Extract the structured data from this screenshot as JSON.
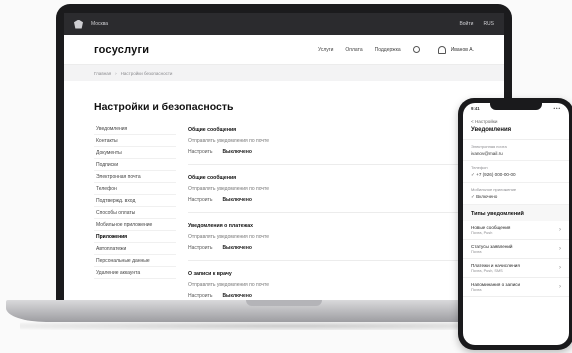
{
  "laptop": {
    "topbar": {
      "region": "Москва",
      "right_a": "Войти",
      "right_b": "RUS"
    },
    "header": {
      "logo": "госуслуги",
      "nav": [
        "Услуги",
        "Оплата",
        "Поддержка"
      ],
      "user_name": "Иванов А."
    },
    "breadcrumb": [
      "Главная",
      "Настройки безопасности"
    ],
    "page_title": "Настройки и безопасность",
    "sidebar": [
      "Уведомления",
      "Контакты",
      "Документы",
      "Подписки",
      "Электронная почта",
      "Телефон",
      "Подтвержд. вход",
      "Способы оплаты",
      "Мобильное приложение",
      "Приложения",
      "Автоплатежи",
      "Персональные данные",
      "Удаление аккаунта"
    ],
    "sections": [
      {
        "title": "Общие сообщения",
        "sub": "Отправлять уведомления по почте",
        "channel_label": "Настроить",
        "channel_value": "Выключено"
      },
      {
        "title": "Общие сообщения",
        "sub": "Отправлять уведомления по почте",
        "channel_label": "Настроить",
        "channel_value": "Выключено"
      },
      {
        "title": "Уведомления о платежах",
        "sub": "Отправлять уведомления по почте",
        "channel_label": "Настроить",
        "channel_value": "Выключено"
      },
      {
        "title": "О записи к врачу",
        "sub": "Отправлять уведомления по почте",
        "channel_label": "Настроить",
        "channel_value": "Выключено"
      }
    ]
  },
  "phone": {
    "time": "9:41",
    "signal": "•••",
    "back_label": "< Настройки",
    "title": "Уведомления",
    "blocks": [
      {
        "label": "Электронная почта",
        "value": "ivanov@mail.ru"
      },
      {
        "label": "Телефон",
        "check": "+7 (926) 000-00-00"
      },
      {
        "label": "Мобильное приложение",
        "check": "Включено"
      }
    ],
    "section_title": "Типы уведомлений",
    "rows": [
      {
        "title": "Новые сообщения",
        "subtitle": "Почта, Push"
      },
      {
        "title": "Статусы заявлений",
        "subtitle": "Почта"
      },
      {
        "title": "Платежи и начисления",
        "subtitle": "Почта, Push, SMS"
      },
      {
        "title": "Напоминания о записи",
        "subtitle": "Почта"
      }
    ]
  },
  "colors": {
    "topbar": "#2b2b2e",
    "device": "#1b1b1d"
  }
}
